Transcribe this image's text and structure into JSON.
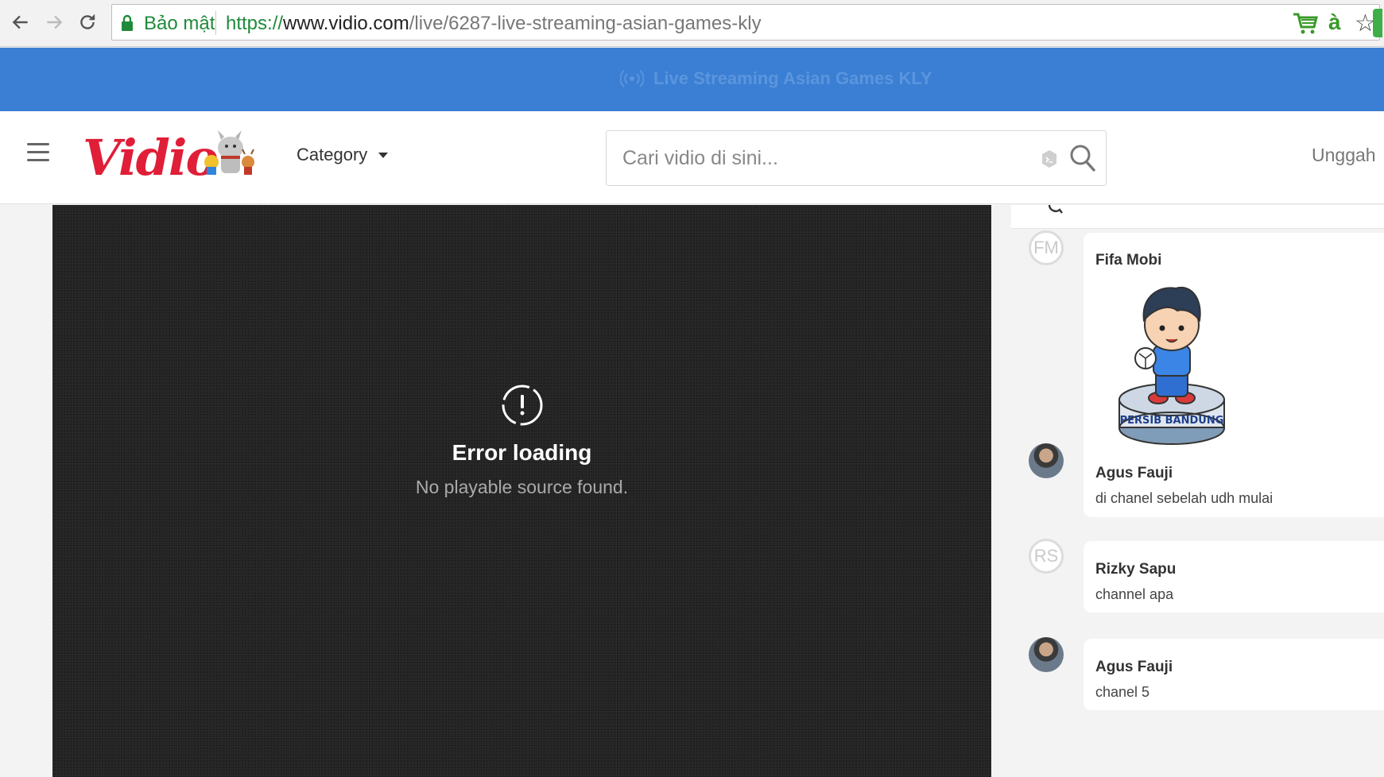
{
  "browser": {
    "secure_label": "Bảo mật",
    "url_scheme": "https://",
    "url_host": "www.vidio.com",
    "url_path": "/live/6287-live-streaming-asian-games-kly",
    "ext_letter": "à",
    "star_glyph": "☆"
  },
  "banner": {
    "text": "Live Streaming Asian Games KLY"
  },
  "header": {
    "logo_text": "Vidio",
    "category_label": "Category",
    "search_placeholder": "Cari vidio di sini...",
    "upload_label": "Unggah"
  },
  "player": {
    "error_title": "Error loading",
    "error_message": "No playable source found."
  },
  "chat": {
    "messages": [
      {
        "name": "Fifa Mobi",
        "initials": "FM",
        "text": "",
        "sticker_label": "PERSIB BANDUNG"
      },
      {
        "name": "Agus Fauji",
        "initials": "",
        "text": "di chanel sebelah udh mulai"
      },
      {
        "name": "Rizky Sapu",
        "initials": "RS",
        "text": "channel apa"
      },
      {
        "name": "Agus Fauji",
        "initials": "",
        "text": "chanel 5"
      }
    ]
  },
  "colors": {
    "banner_blue": "#3b7fd4",
    "brand_red": "#e01e37",
    "secure_green": "#1f8a3a",
    "player_bg": "#232323"
  }
}
